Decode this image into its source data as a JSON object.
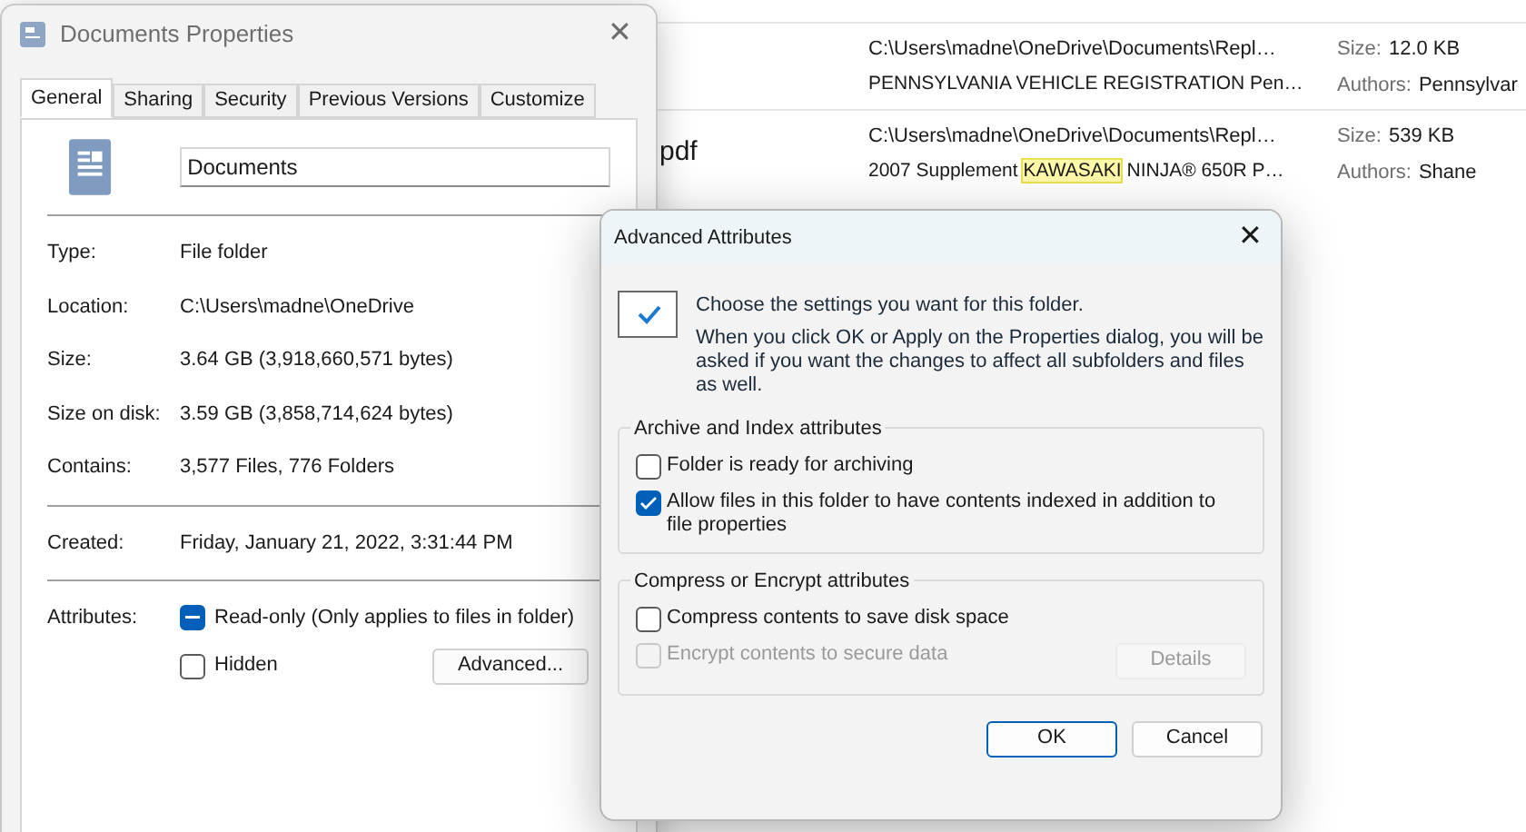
{
  "explorer": {
    "rows": [
      {
        "path": "C:\\Users\\madne\\OneDrive\\Documents\\Repl…",
        "description": [
          {
            "text": "PENNSYLVANIA VEHICLE REGISTRATION Pen…",
            "highlight": false
          }
        ],
        "size_label": "Size:",
        "size": "12.0 KB",
        "authors_label": "Authors:",
        "authors": "Pennsylvar"
      },
      {
        "name": "pdf",
        "path": "C:\\Users\\madne\\OneDrive\\Documents\\Repl…",
        "description": [
          {
            "text": "2007 Supplement ",
            "highlight": false
          },
          {
            "text": "KAWASAKI",
            "highlight": true
          },
          {
            "text": " NINJA® 650R P…",
            "highlight": false
          }
        ],
        "size_label": "Size:",
        "size": "539 KB",
        "authors_label": "Authors:",
        "authors": "Shane"
      }
    ]
  },
  "properties": {
    "title": "Documents Properties",
    "close": "✕",
    "tabs": [
      {
        "label": "General",
        "selected": true
      },
      {
        "label": "Sharing",
        "selected": false
      },
      {
        "label": "Security",
        "selected": false
      },
      {
        "label": "Previous Versions",
        "selected": false
      },
      {
        "label": "Customize",
        "selected": false
      }
    ],
    "name_value": "Documents",
    "groups": [
      [
        {
          "label": "Type:",
          "value": "File folder"
        },
        {
          "label": "Location:",
          "value": "C:\\Users\\madne\\OneDrive"
        },
        {
          "label": "Size:",
          "value": "3.64 GB (3,918,660,571 bytes)"
        },
        {
          "label": "Size on disk:",
          "value": "3.59 GB (3,858,714,624 bytes)"
        },
        {
          "label": "Contains:",
          "value": "3,577 Files, 776 Folders"
        }
      ],
      [
        {
          "label": "Created:",
          "value": "Friday, January 21, 2022, 3:31:44 PM"
        }
      ]
    ],
    "attributes_label": "Attributes:",
    "attributes": [
      {
        "label": "Read-only (Only applies to files in folder)",
        "indeterminate": true
      },
      {
        "label": "Hidden",
        "checked": false,
        "indeterminate": false
      }
    ],
    "advanced_button": "Advanced..."
  },
  "advanced": {
    "title": "Advanced Attributes",
    "close": "✕",
    "intro": "Choose the settings you want for this folder.",
    "note": "When you click OK or Apply on the Properties dialog, you will be asked if you want the changes to affect all subfolders and files as well.",
    "groups": [
      {
        "title": "Archive and Index attributes",
        "options": [
          {
            "label": "Folder is ready for archiving",
            "checked": false,
            "disabled": false
          },
          {
            "label": "Allow files in this folder to have contents indexed in addition to file properties",
            "checked": true,
            "disabled": false
          }
        ]
      },
      {
        "title": "Compress or Encrypt attributes",
        "options": [
          {
            "label": "Compress contents to save disk space",
            "checked": false,
            "disabled": false
          },
          {
            "label": "Encrypt contents to secure data",
            "checked": false,
            "disabled": true
          }
        ],
        "button": {
          "label": "Details",
          "disabled": true
        }
      }
    ],
    "buttons": [
      {
        "label": "OK",
        "default": true
      },
      {
        "label": "Cancel",
        "default": false
      }
    ]
  }
}
